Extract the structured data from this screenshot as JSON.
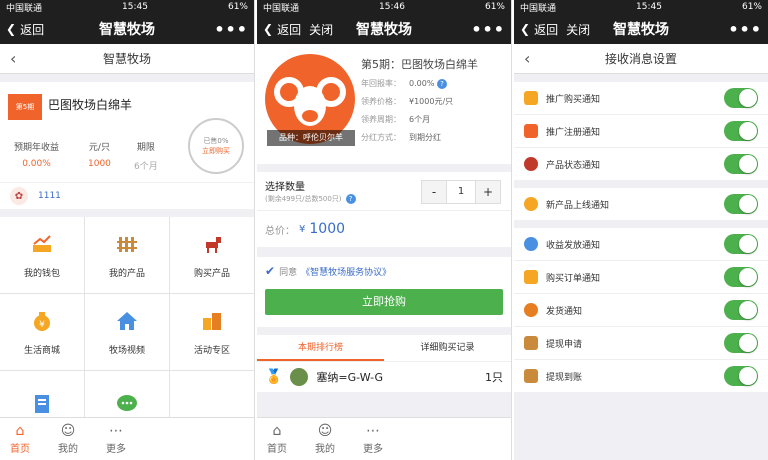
{
  "screen1": {
    "status": {
      "carrier": "中国联通",
      "time": "15:45",
      "battery": "61%"
    },
    "titlebar": {
      "back": "返回",
      "title": "智慧牧场",
      "more": "•••"
    },
    "subhead": {
      "title": "智慧牧场"
    },
    "product": {
      "badge": "第5期",
      "name": "巴图牧场白绵羊",
      "stats": [
        {
          "label": "预期年收益",
          "value": "0.00%"
        },
        {
          "label": "元/只",
          "value": "1000"
        },
        {
          "label": "期限",
          "value": "6个月"
        }
      ],
      "ring": {
        "sold": "已售0%",
        "cta": "立即购买"
      }
    },
    "user": {
      "name": "1111"
    },
    "grid": [
      {
        "label": "我的钱包",
        "icon": "wallet-chart-icon"
      },
      {
        "label": "我的产品",
        "icon": "fence-icon"
      },
      {
        "label": "购买产品",
        "icon": "goat-icon"
      },
      {
        "label": "生活商城",
        "icon": "money-bag-icon"
      },
      {
        "label": "牧场视频",
        "icon": "house-icon"
      },
      {
        "label": "活动专区",
        "icon": "buildings-icon"
      },
      {
        "label": "",
        "icon": "document-icon"
      },
      {
        "label": "",
        "icon": "chat-icon"
      },
      {
        "label": "",
        "icon": ""
      }
    ],
    "tabs": [
      {
        "label": "首页",
        "icon": "home-icon"
      },
      {
        "label": "我的",
        "icon": "user-icon"
      },
      {
        "label": "更多",
        "icon": "more-icon"
      }
    ]
  },
  "screen2": {
    "status": {
      "carrier": "中国联通",
      "time": "15:46",
      "battery": "61%"
    },
    "titlebar": {
      "back": "返回",
      "close": "关闭",
      "title": "智慧牧场",
      "more": "•••"
    },
    "hero": {
      "breed": "品种：呼伦贝尔羊",
      "title": "第5期：巴图牧场白绵羊",
      "rows": [
        {
          "k": "年回报率：",
          "v": "0.00%"
        },
        {
          "k": "领养价格：",
          "v": "¥1000元/只"
        },
        {
          "k": "领养周期：",
          "v": "6个月"
        },
        {
          "k": "分红方式：",
          "v": "到期分红"
        }
      ]
    },
    "quantity": {
      "label": "选择数量",
      "note": "(剩余499只/总数500只)",
      "minus": "-",
      "value": "1",
      "plus": "+"
    },
    "total": {
      "label": "总价：",
      "currency": "¥",
      "amount": "1000"
    },
    "agree": {
      "prefix": "同意",
      "link": "《智慧牧场服务协议》"
    },
    "buy_button": "立即抢购",
    "tabs": [
      {
        "label": "本期排行榜"
      },
      {
        "label": "详细购买记录"
      }
    ],
    "rank": {
      "name": "塞纳=G-W-G",
      "count": "1只"
    },
    "bottom_tabs": [
      {
        "label": "首页",
        "icon": "home-icon"
      },
      {
        "label": "我的",
        "icon": "user-icon"
      },
      {
        "label": "更多",
        "icon": "more-icon"
      }
    ]
  },
  "screen3": {
    "status": {
      "carrier": "中国联通",
      "time": "15:45",
      "battery": "61%"
    },
    "titlebar": {
      "back": "返回",
      "close": "关闭",
      "title": "智慧牧场",
      "more": "•••"
    },
    "subhead": {
      "title": "接收消息设置"
    },
    "groups": [
      [
        {
          "label": "推广购买通知",
          "icon": "megaphone-icon",
          "on": true
        },
        {
          "label": "推广注册通知",
          "icon": "bar-chart-icon",
          "on": true
        },
        {
          "label": "产品状态通知",
          "icon": "goat-icon",
          "on": true
        }
      ],
      [
        {
          "label": "新产品上线通知",
          "icon": "money-bag-icon",
          "on": true
        }
      ],
      [
        {
          "label": "收益发放通知",
          "icon": "globe-icon",
          "on": true
        },
        {
          "label": "购买订单通知",
          "icon": "person-icon",
          "on": true
        },
        {
          "label": "发货通知",
          "icon": "gear-icon",
          "on": true
        },
        {
          "label": "提现申请",
          "icon": "coins-icon",
          "on": true
        },
        {
          "label": "提现到账",
          "icon": "coins-icon",
          "on": true
        }
      ]
    ]
  }
}
